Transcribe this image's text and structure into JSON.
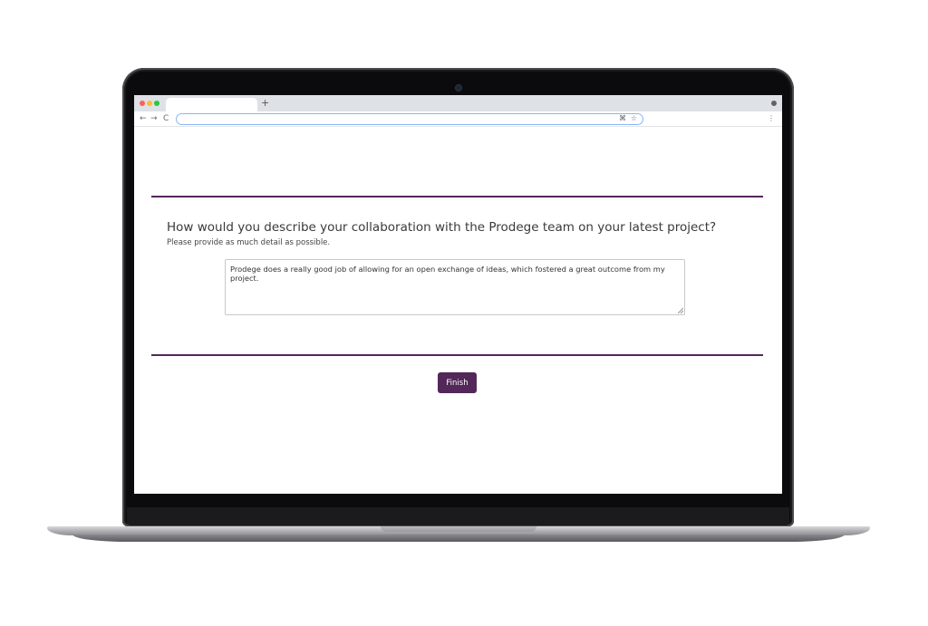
{
  "browser": {
    "new_tab_label": "+",
    "nav_back": "←",
    "nav_forward": "→",
    "nav_reload": "C",
    "omnibox_cmd_icon": "⌘",
    "omnibox_star_icon": "☆",
    "menu_icon": "⋮"
  },
  "survey": {
    "question": "How would you describe your collaboration with the Prodege team on your latest project?",
    "instruction": "Please provide as much detail as possible.",
    "answer": "Prodege does a really good job of allowing for an open exchange of ideas, which fostered a great outcome from my project.",
    "finish_label": "Finish"
  },
  "colors": {
    "accent": "#53275a",
    "window_close": "#ff5f57",
    "window_minimize": "#febc2e",
    "window_maximize": "#28c840"
  }
}
